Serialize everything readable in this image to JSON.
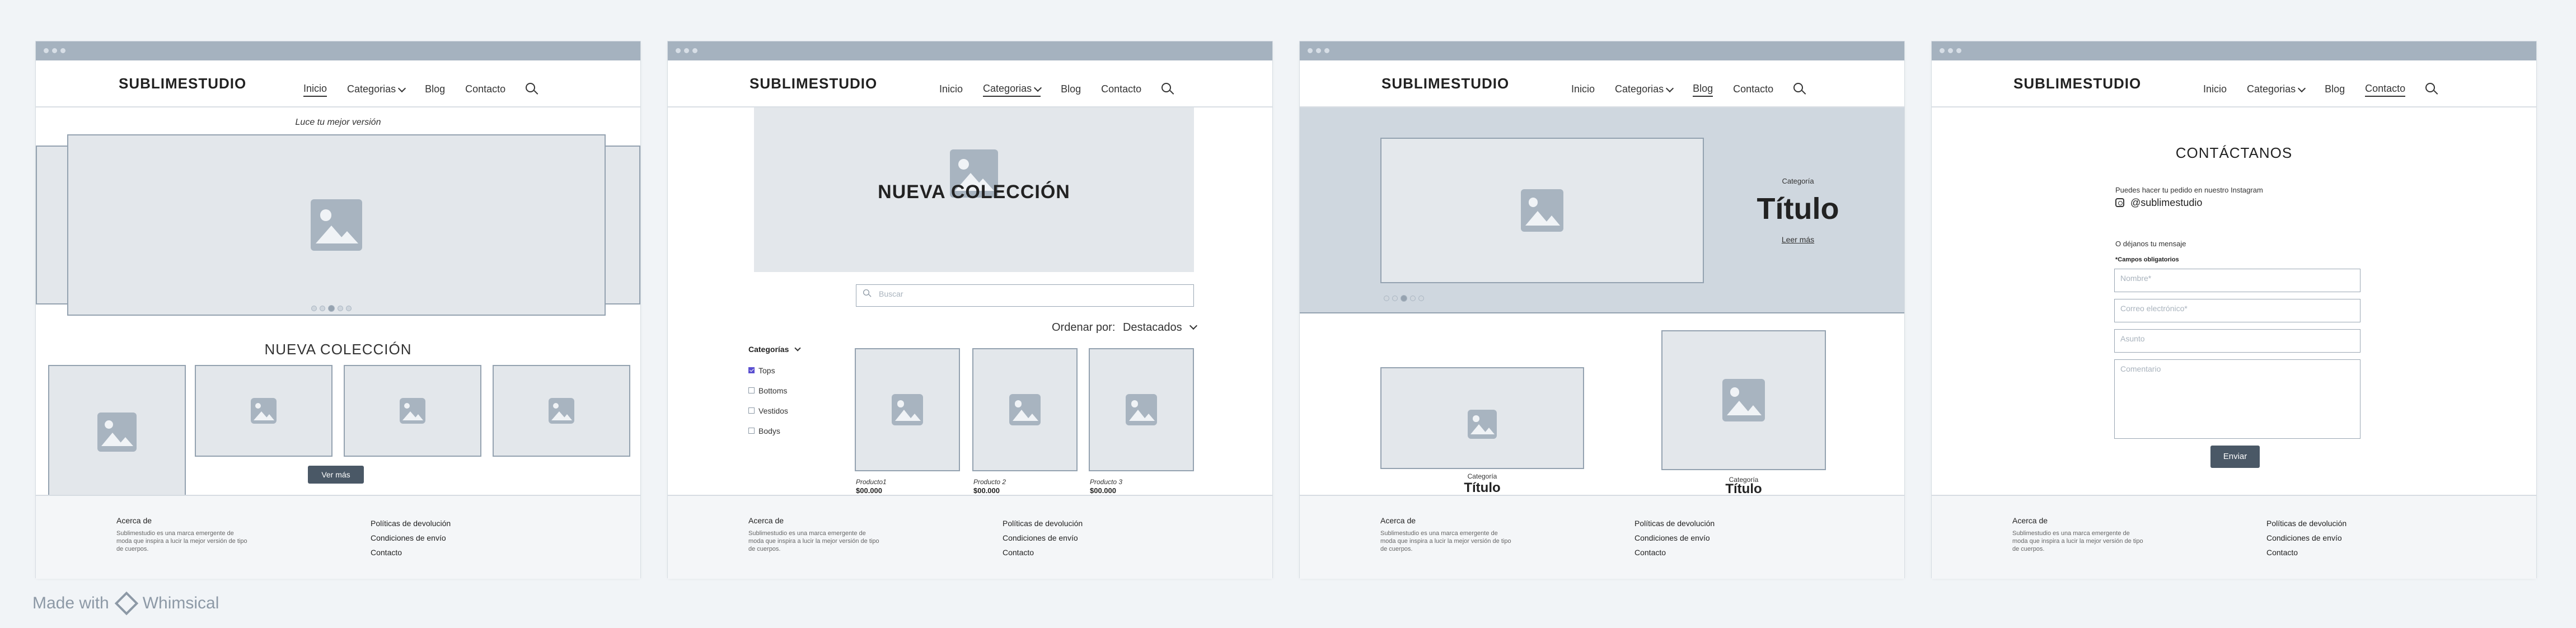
{
  "brand": "SUBLIMESTUDIO",
  "nav": {
    "inicio": "Inicio",
    "categorias": "Categorias",
    "blog": "Blog",
    "contacto": "Contacto"
  },
  "footer": {
    "about_title": "Acerca de",
    "about_desc": "Sublimestudio  es una marca emergente de moda que inspira a lucir la mejor versión de tipo de cuerpos.",
    "links": [
      "Políticas de devolución",
      "Condiciones de envío",
      "Contacto"
    ]
  },
  "home": {
    "tagline": "Luce tu mejor versión",
    "collection_title": "NUEVA COLECCIÓN",
    "more_button": "Ver más"
  },
  "category": {
    "banner_title": "NUEVA COLECCIÓN",
    "search_placeholder": "Buscar",
    "sort_label": "Ordenar por:",
    "sort_value": "Destacados",
    "filter_title": "Categorías",
    "filters": [
      {
        "label": "Tops",
        "checked": true
      },
      {
        "label": "Bottoms",
        "checked": false
      },
      {
        "label": "Vestidos",
        "checked": false
      },
      {
        "label": "Bodys",
        "checked": false
      }
    ],
    "products": [
      {
        "name": "Producto1",
        "price": "$00.000"
      },
      {
        "name": "Producto 2",
        "price": "$00.000"
      },
      {
        "name": "Producto 3",
        "price": "$00.000"
      }
    ]
  },
  "blog": {
    "hero_category": "Categoría",
    "hero_title": "Título",
    "hero_link": "Leer más",
    "posts": [
      {
        "category": "Categoría",
        "title": "Título"
      },
      {
        "category": "Categoría",
        "title": "Título"
      }
    ]
  },
  "contact": {
    "title": "CONTÁCTANOS",
    "instagram_text": "Puedes hacer tu pedido en nuestro Instagram",
    "instagram_handle": "@sublimestudio",
    "message_text": "O déjanos tu mensaje",
    "required_note": "*Campos obligatorios",
    "name_placeholder": "Nombre*",
    "email_placeholder": "Correo electrónico*",
    "subject_placeholder": "Asunto",
    "comment_placeholder": "Comentario",
    "send_button": "Enviar"
  },
  "watermark": {
    "made_with": "Made with",
    "brand": "Whimsical"
  }
}
